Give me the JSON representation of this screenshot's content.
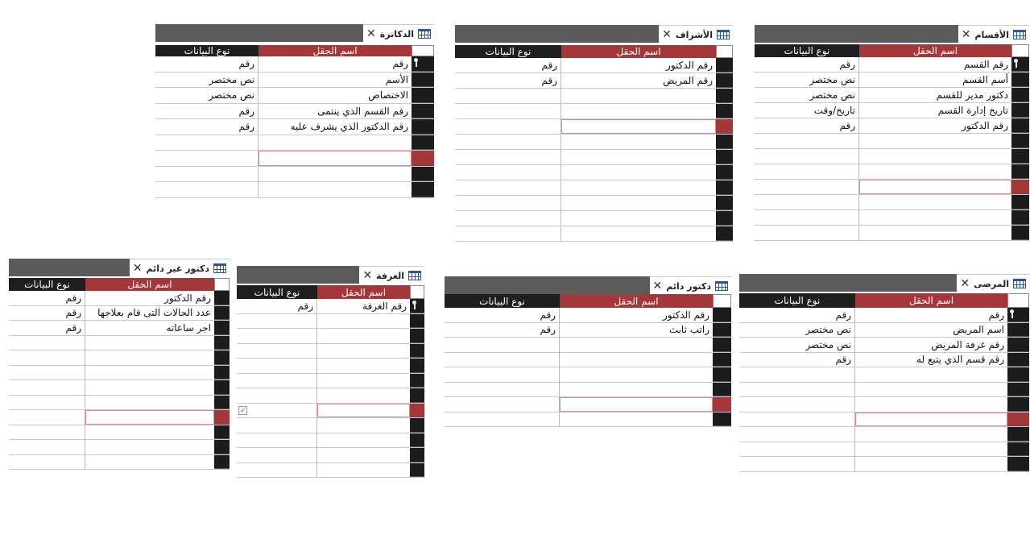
{
  "headers": {
    "field_name": "اسم الحقل",
    "data_type": "نوع البيانات"
  },
  "tables": [
    {
      "id": "doctors",
      "title": "الدكاترة",
      "fields": [
        {
          "name": "رقم",
          "type": "رقم",
          "key": true
        },
        {
          "name": "الأسم",
          "type": "نص مختصر"
        },
        {
          "name": "الاختصاص",
          "type": "نص مختصر"
        },
        {
          "name": "رقم القسم الذي ينتمى",
          "type": "رقم"
        },
        {
          "name": "رقم الدكتور الذي يشرف عليه",
          "type": "رقم"
        },
        {
          "name": "",
          "type": ""
        },
        {
          "name": "",
          "type": "",
          "active": true
        },
        {
          "name": "",
          "type": ""
        },
        {
          "name": "",
          "type": ""
        }
      ]
    },
    {
      "id": "supervision",
      "title": "الأشراف",
      "fields": [
        {
          "name": "رقم الدكتور",
          "type": "رقم"
        },
        {
          "name": "رقم المريض",
          "type": "رقم"
        },
        {
          "name": "",
          "type": ""
        },
        {
          "name": "",
          "type": ""
        },
        {
          "name": "",
          "type": "",
          "active": true
        },
        {
          "name": "",
          "type": ""
        },
        {
          "name": "",
          "type": ""
        },
        {
          "name": "",
          "type": ""
        },
        {
          "name": "",
          "type": ""
        },
        {
          "name": "",
          "type": ""
        },
        {
          "name": "",
          "type": ""
        },
        {
          "name": "",
          "type": ""
        }
      ]
    },
    {
      "id": "departments",
      "title": "الأقسام",
      "fields": [
        {
          "name": "رقم القسم",
          "type": "رقم",
          "key": true
        },
        {
          "name": "أسم القسم",
          "type": "نص مختصر"
        },
        {
          "name": "دكتور مدير للقسم",
          "type": "نص مختصر"
        },
        {
          "name": "تاريخ إدارة القسم",
          "type": "تاريخ/وقت"
        },
        {
          "name": "رقم الدكتور",
          "type": "رقم"
        },
        {
          "name": "",
          "type": ""
        },
        {
          "name": "",
          "type": ""
        },
        {
          "name": "",
          "type": ""
        },
        {
          "name": "",
          "type": "",
          "active": true
        },
        {
          "name": "",
          "type": ""
        },
        {
          "name": "",
          "type": ""
        },
        {
          "name": "",
          "type": ""
        }
      ]
    },
    {
      "id": "nonpermanent",
      "title": "دكتور غير دائم",
      "fields": [
        {
          "name": "رقم الدكتور",
          "type": "رقم"
        },
        {
          "name": "عدد الحالات التى قام بعلاجها",
          "type": "رقم"
        },
        {
          "name": "اجر ساعاته",
          "type": "رقم"
        },
        {
          "name": "",
          "type": ""
        },
        {
          "name": "",
          "type": ""
        },
        {
          "name": "",
          "type": ""
        },
        {
          "name": "",
          "type": ""
        },
        {
          "name": "",
          "type": ""
        },
        {
          "name": "",
          "type": "",
          "active": true
        },
        {
          "name": "",
          "type": ""
        },
        {
          "name": "",
          "type": ""
        },
        {
          "name": "",
          "type": ""
        }
      ]
    },
    {
      "id": "room",
      "title": "الغرفة",
      "fields": [
        {
          "name": "رقم الغرفة",
          "type": "رقم",
          "key": true
        },
        {
          "name": "",
          "type": ""
        },
        {
          "name": "",
          "type": ""
        },
        {
          "name": "",
          "type": ""
        },
        {
          "name": "",
          "type": ""
        },
        {
          "name": "",
          "type": ""
        },
        {
          "name": "",
          "type": ""
        },
        {
          "name": "",
          "type": "",
          "active": true,
          "dropdown": true
        },
        {
          "name": "",
          "type": ""
        },
        {
          "name": "",
          "type": ""
        },
        {
          "name": "",
          "type": ""
        },
        {
          "name": "",
          "type": ""
        }
      ]
    },
    {
      "id": "permanent",
      "title": "دكتور دائم",
      "fields": [
        {
          "name": "رقم الدكتور",
          "type": "رقم"
        },
        {
          "name": "راتب ثابث",
          "type": "رقم"
        },
        {
          "name": "",
          "type": ""
        },
        {
          "name": "",
          "type": ""
        },
        {
          "name": "",
          "type": ""
        },
        {
          "name": "",
          "type": ""
        },
        {
          "name": "",
          "type": "",
          "active": true
        },
        {
          "name": "",
          "type": ""
        }
      ]
    },
    {
      "id": "patients",
      "title": "المرضى",
      "fields": [
        {
          "name": "رقم",
          "type": "رقم",
          "key": true
        },
        {
          "name": "اسم المريض",
          "type": "نص مختصر"
        },
        {
          "name": "رقم غرفة المريض",
          "type": "نص مختصر"
        },
        {
          "name": "رقم قسم الذي يتبع له",
          "type": "رقم"
        },
        {
          "name": "",
          "type": ""
        },
        {
          "name": "",
          "type": ""
        },
        {
          "name": "",
          "type": ""
        },
        {
          "name": "",
          "type": "",
          "active": true
        },
        {
          "name": "",
          "type": ""
        },
        {
          "name": "",
          "type": ""
        },
        {
          "name": "",
          "type": ""
        }
      ]
    }
  ]
}
